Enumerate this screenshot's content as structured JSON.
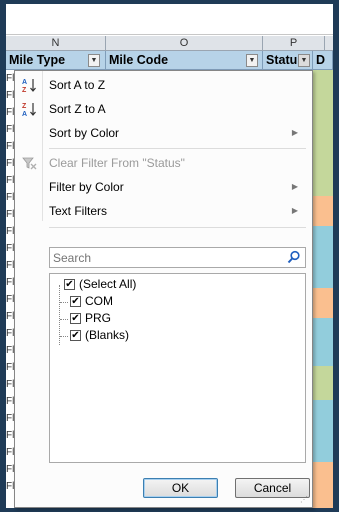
{
  "columns": {
    "letters": [
      "N",
      "O",
      "P"
    ],
    "headers": [
      "Mile Type",
      "Mile Code",
      "Statu",
      "D"
    ]
  },
  "left_strip_text": "Fl",
  "colors": {
    "row_green": "#c4d79b",
    "row_orange": "#fabf8f",
    "row_blue": "#92cddc",
    "header_blue": "#b7d3e8",
    "frame": "#1f3b57"
  },
  "menu": {
    "sort_az": "Sort A to Z",
    "sort_za": "Sort Z to A",
    "sort_color": "Sort by Color",
    "clear_filter": "Clear Filter From \"Status\"",
    "filter_color": "Filter by Color",
    "text_filters": "Text Filters",
    "search_placeholder": "Search",
    "items": [
      "(Select All)",
      "COM",
      "PRG",
      "(Blanks)"
    ],
    "ok": "OK",
    "cancel": "Cancel"
  }
}
